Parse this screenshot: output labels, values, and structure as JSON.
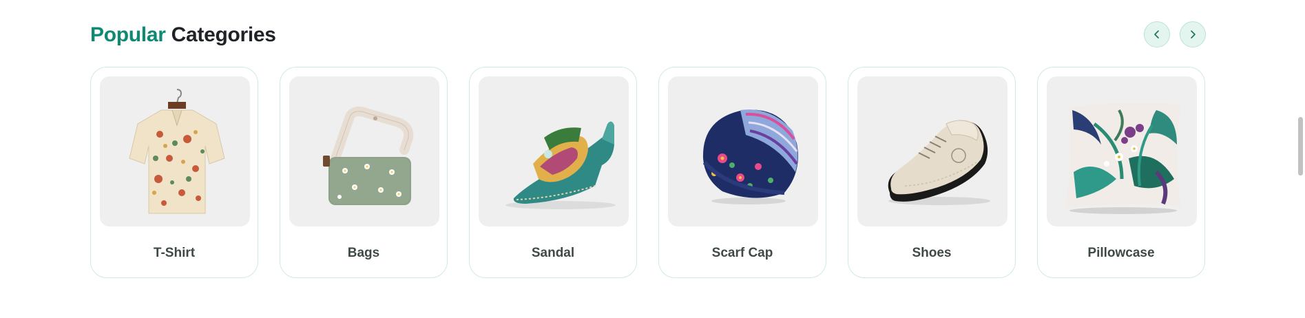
{
  "section": {
    "title_accent": "Popular",
    "title_rest": " Categories"
  },
  "nav": {
    "prev_icon": "chevron-left-icon",
    "next_icon": "chevron-right-icon"
  },
  "categories": [
    {
      "label": "T-Shirt",
      "icon": "shirt-image"
    },
    {
      "label": "Bags",
      "icon": "bag-image"
    },
    {
      "label": "Sandal",
      "icon": "sandal-image"
    },
    {
      "label": "Scarf Cap",
      "icon": "cap-image"
    },
    {
      "label": "Shoes",
      "icon": "shoe-image"
    },
    {
      "label": "Pillowcase",
      "icon": "pillow-image"
    }
  ],
  "colors": {
    "accent": "#0e8a73",
    "title": "#1f2328",
    "card_border": "#cfeae1",
    "nav_bg": "#e4f5ef"
  }
}
